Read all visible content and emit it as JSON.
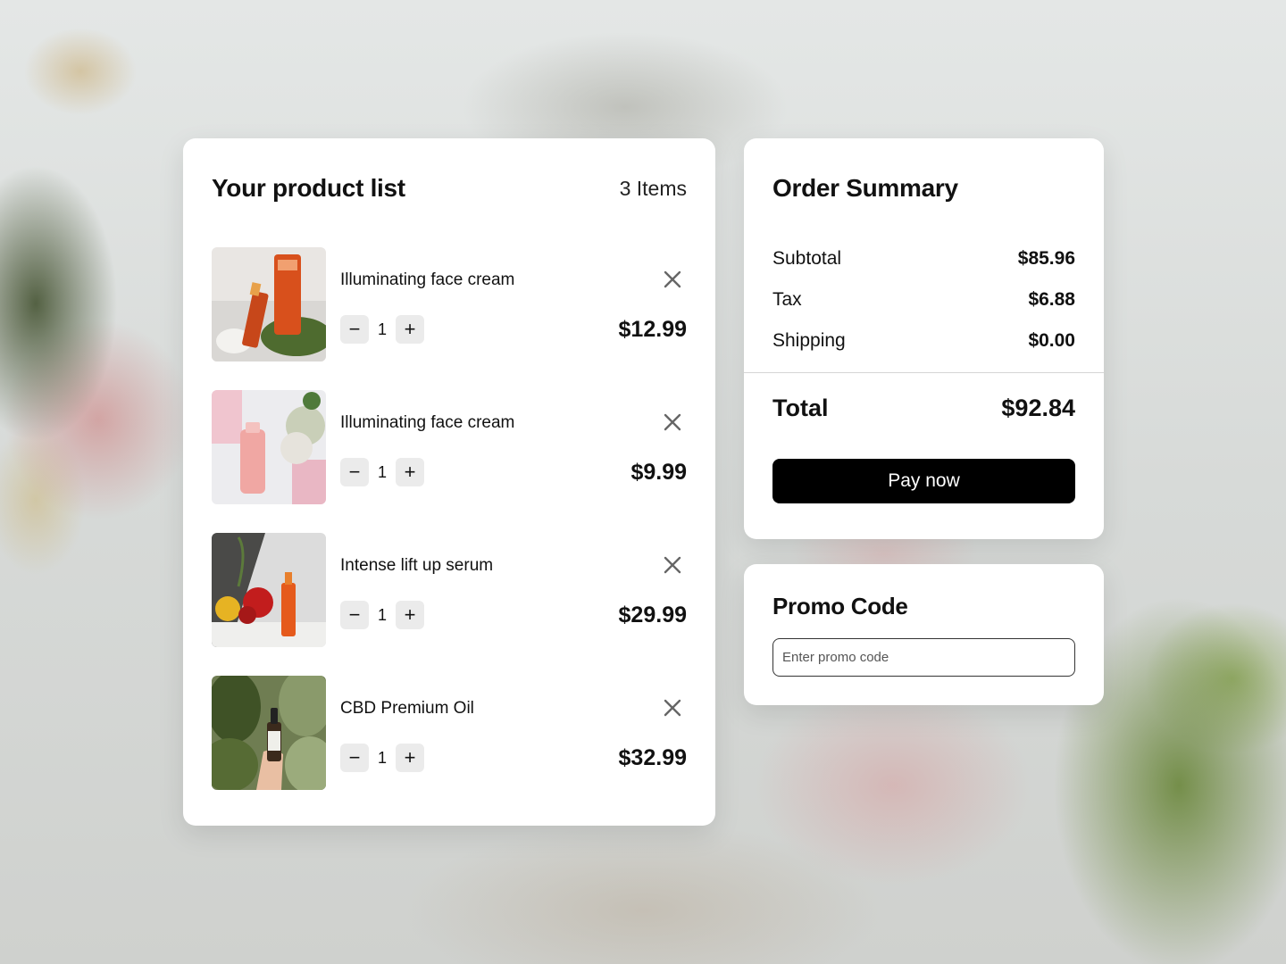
{
  "products_panel": {
    "title": "Your product list",
    "items_count": "3 Items",
    "products": [
      {
        "name": "Illuminating face cream",
        "quantity": "1",
        "price": "$12.99",
        "image_icon": "orange-cream-tubes-image"
      },
      {
        "name": "Illuminating face cream",
        "quantity": "1",
        "price": "$9.99",
        "image_icon": "pink-bottle-flowers-image"
      },
      {
        "name": "Intense lift up serum",
        "quantity": "1",
        "price": "$29.99",
        "image_icon": "serum-bottle-roses-image"
      },
      {
        "name": "CBD Premium Oil",
        "quantity": "1",
        "price": "$32.99",
        "image_icon": "oil-dropper-leaves-image"
      }
    ],
    "decrement_symbol": "−",
    "increment_symbol": "+"
  },
  "order_summary": {
    "title": "Order Summary",
    "rows": [
      {
        "label": "Subtotal",
        "value": "$85.96"
      },
      {
        "label": "Tax",
        "value": "$6.88"
      },
      {
        "label": "Shipping",
        "value": "$0.00"
      }
    ],
    "total_label": "Total",
    "total_value": "$92.84",
    "pay_label": "Pay now"
  },
  "promo": {
    "title": "Promo Code",
    "placeholder": "Enter promo code",
    "value": ""
  },
  "colors": {
    "pay_button": "#000000",
    "qty_button_bg": "#ebebeb",
    "card_bg": "#ffffff"
  }
}
